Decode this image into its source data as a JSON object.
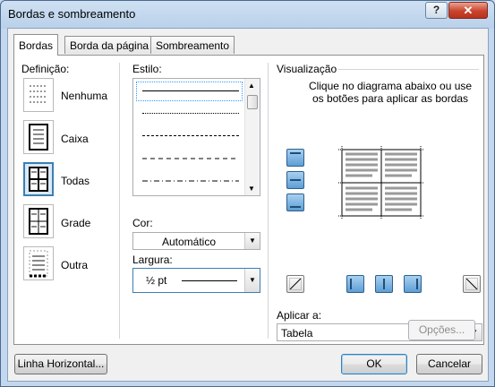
{
  "window": {
    "title": "Bordas e sombreamento",
    "help_glyph": "?",
    "close_glyph": "✕"
  },
  "tabs": [
    {
      "label": "Bordas",
      "active": true
    },
    {
      "label": "Borda da página",
      "active": false
    },
    {
      "label": "Sombreamento",
      "active": false
    }
  ],
  "settings": {
    "heading": "Definição:",
    "items": [
      {
        "label": "Nenhuma",
        "icon": "border-none-icon"
      },
      {
        "label": "Caixa",
        "icon": "border-box-icon"
      },
      {
        "label": "Todas",
        "icon": "border-all-icon",
        "selected": true
      },
      {
        "label": "Grade",
        "icon": "border-grid-icon"
      },
      {
        "label": "Outra",
        "icon": "border-custom-icon"
      }
    ]
  },
  "style": {
    "heading": "Estilo:",
    "options": [
      "solid",
      "dotted",
      "dashed-small",
      "dashed",
      "dash-dot"
    ],
    "selected": "solid"
  },
  "color": {
    "label": "Cor:",
    "value": "Automático"
  },
  "width": {
    "label": "Largura:",
    "value": "½ pt"
  },
  "preview": {
    "heading": "Visualização",
    "instructions": "Clique no diagrama abaixo ou use os botões para aplicar as bordas",
    "apply_label": "Aplicar a:",
    "apply_value": "Tabela",
    "options_button": "Opções..."
  },
  "footer": {
    "horizontal_line": "Linha Horizontal...",
    "ok": "OK",
    "cancel": "Cancelar"
  },
  "colors": {
    "accent": "#3c7fb1",
    "preview_button": "#5e9ed4"
  }
}
